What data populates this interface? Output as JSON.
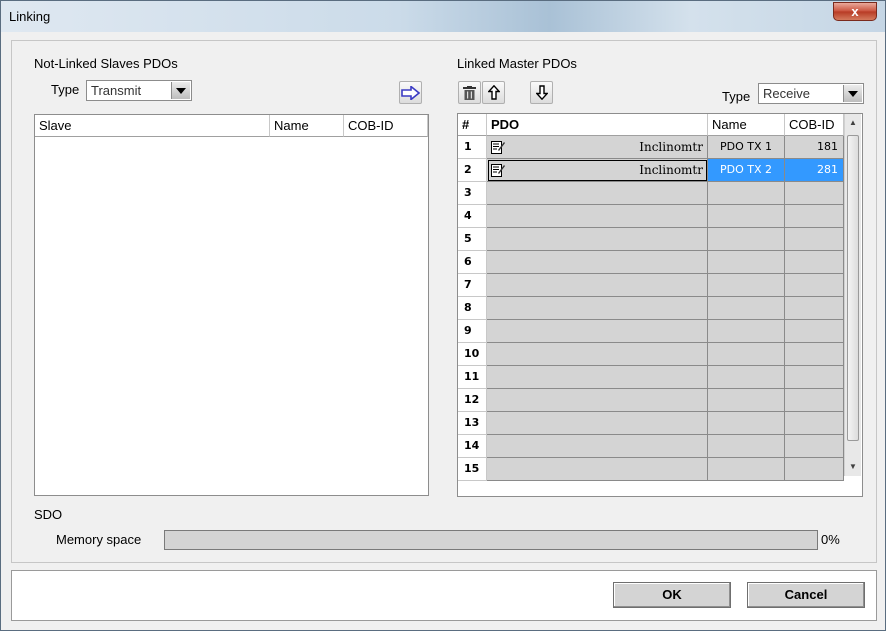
{
  "window": {
    "title": "Linking",
    "close_symbol": "x"
  },
  "left_panel": {
    "title": "Not-Linked Slaves PDOs",
    "type_label": "Type",
    "type_value": "Transmit",
    "columns": [
      "Slave",
      "Name",
      "COB-ID"
    ]
  },
  "right_panel": {
    "title": "Linked Master PDOs",
    "type_label": "Type",
    "type_value": "Receive",
    "columns": [
      "#",
      "PDO",
      "Name",
      "COB-ID"
    ],
    "rows": [
      {
        "num": "1",
        "pdo": "Inclinomtr",
        "name": "PDO TX 1",
        "cob": "181"
      },
      {
        "num": "2",
        "pdo": "Inclinomtr",
        "name": "PDO TX 2",
        "cob": "281"
      },
      {
        "num": "3",
        "pdo": "",
        "name": "",
        "cob": ""
      },
      {
        "num": "4",
        "pdo": "",
        "name": "",
        "cob": ""
      },
      {
        "num": "5",
        "pdo": "",
        "name": "",
        "cob": ""
      },
      {
        "num": "6",
        "pdo": "",
        "name": "",
        "cob": ""
      },
      {
        "num": "7",
        "pdo": "",
        "name": "",
        "cob": ""
      },
      {
        "num": "8",
        "pdo": "",
        "name": "",
        "cob": ""
      },
      {
        "num": "9",
        "pdo": "",
        "name": "",
        "cob": ""
      },
      {
        "num": "10",
        "pdo": "",
        "name": "",
        "cob": ""
      },
      {
        "num": "11",
        "pdo": "",
        "name": "",
        "cob": ""
      },
      {
        "num": "12",
        "pdo": "",
        "name": "",
        "cob": ""
      },
      {
        "num": "13",
        "pdo": "",
        "name": "",
        "cob": ""
      },
      {
        "num": "14",
        "pdo": "",
        "name": "",
        "cob": ""
      },
      {
        "num": "15",
        "pdo": "",
        "name": "",
        "cob": ""
      }
    ]
  },
  "sdo": {
    "title": "SDO",
    "memory_label": "Memory space",
    "percent": "0%",
    "fill_fraction": 0
  },
  "buttons": {
    "ok": "OK",
    "cancel": "Cancel"
  },
  "colors": {
    "selection": "#3399ff",
    "cell_gray": "#d4d4d4",
    "accent_arrow": "#3b3bc4"
  },
  "icons": [
    "link-arrow-icon",
    "delete-icon",
    "move-up-icon",
    "move-down-icon",
    "edit-icon"
  ]
}
